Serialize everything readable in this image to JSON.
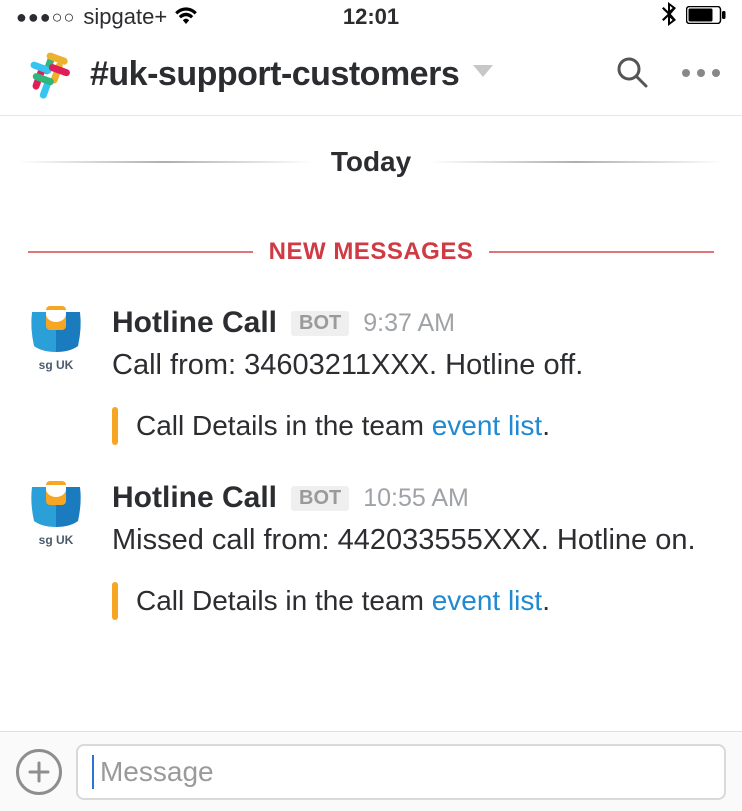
{
  "status": {
    "carrier": "sipgate+",
    "time": "12:01"
  },
  "header": {
    "channel": "#uk-support-customers"
  },
  "dividers": {
    "day": "Today",
    "new": "NEW MESSAGES"
  },
  "messages": [
    {
      "avatar_tag": "sg UK",
      "sender": "Hotline Call",
      "badge": "BOT",
      "time": "9:37 AM",
      "text": "Call from: 34603211XXX. Hotline off.",
      "attachment_prefix": "Call Details in the team ",
      "attachment_link": "event list",
      "attachment_suffix": "."
    },
    {
      "avatar_tag": "sg UK",
      "sender": "Hotline Call",
      "badge": "BOT",
      "time": "10:55 AM",
      "text": "Missed call from: 442033555XXX. Hotline on.",
      "attachment_prefix": "Call Details in the team ",
      "attachment_link": "event list",
      "attachment_suffix": "."
    }
  ],
  "composer": {
    "placeholder": "Message"
  }
}
